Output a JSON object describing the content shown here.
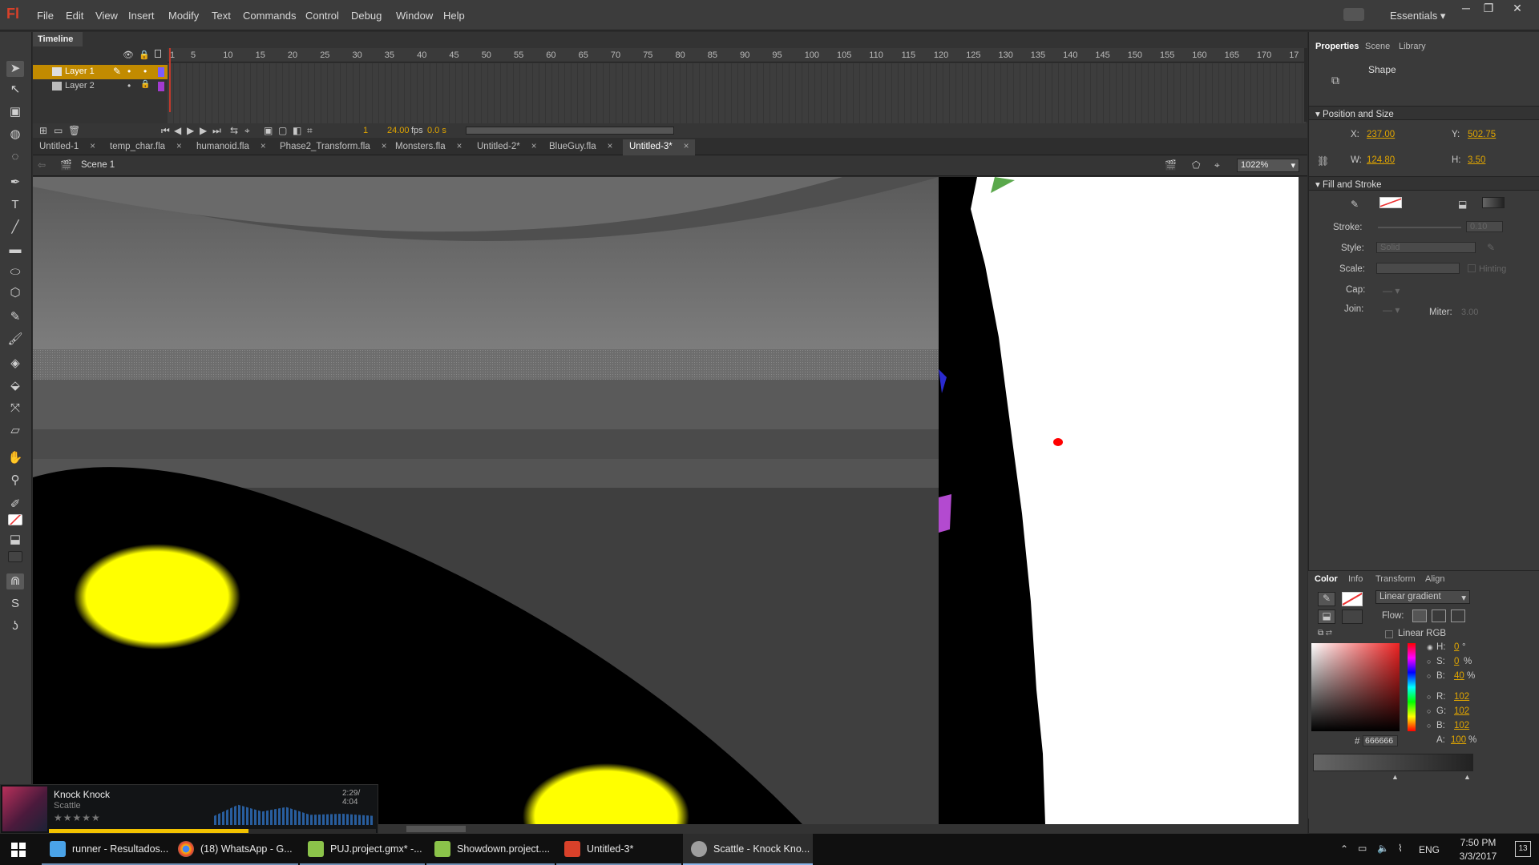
{
  "app": {
    "logo": "Fl",
    "workspace": "Essentials"
  },
  "menu": [
    "File",
    "Edit",
    "View",
    "Insert",
    "Modify",
    "Text",
    "Commands",
    "Control",
    "Debug",
    "Window",
    "Help"
  ],
  "window_controls": {
    "minimize": "─",
    "restore": "❐",
    "close": "✕"
  },
  "timeline": {
    "tab_label": "Timeline",
    "ticks": [
      "1",
      "5",
      "10",
      "15",
      "20",
      "25",
      "30",
      "35",
      "40",
      "45",
      "50",
      "55",
      "60",
      "65",
      "70",
      "75",
      "80",
      "85",
      "90",
      "95",
      "100",
      "105",
      "110",
      "115",
      "120",
      "125",
      "130",
      "135",
      "140",
      "145",
      "150",
      "155",
      "160",
      "165",
      "170",
      "17"
    ],
    "layers": [
      {
        "name": "Layer 1",
        "selected": true,
        "color": "#7b5cff"
      },
      {
        "name": "Layer 2",
        "selected": false,
        "color": "#a23ad0"
      }
    ],
    "current_frame": "1",
    "fps": "24.00",
    "fps_unit": "fps",
    "time": "0.0 s"
  },
  "doc_tabs": [
    "Untitled-1",
    "temp_char.fla",
    "humanoid.fla",
    "Phase2_Transform.fla",
    "Monsters.fla",
    "Untitled-2*",
    "BlueGuy.fla",
    "Untitled-3*"
  ],
  "active_doc_tab": 7,
  "editbar": {
    "scene": "Scene 1",
    "zoom": "1022%"
  },
  "properties": {
    "tabs": [
      "Properties",
      "Scene",
      "Library"
    ],
    "object_type": "Shape",
    "position_section": "Position and Size",
    "x_label": "X:",
    "x_value": "237.00",
    "y_label": "Y:",
    "y_value": "502.75",
    "w_label": "W:",
    "w_value": "124.80",
    "h_label": "H:",
    "h_value": "3.50",
    "fill_section": "Fill and Stroke",
    "stroke_label": "Stroke:",
    "stroke_value": "0.10",
    "style_label": "Style:",
    "style_value": "Solid",
    "scale_label": "Scale:",
    "hinting_label": "Hinting",
    "cap_label": "Cap:",
    "join_label": "Join:",
    "miter_label": "Miter:",
    "miter_value": "3.00"
  },
  "color_panel": {
    "tabs": [
      "Color",
      "Info",
      "Transform",
      "Align"
    ],
    "fill_type": "Linear gradient",
    "flow_label": "Flow:",
    "linear_rgb": "Linear RGB",
    "h_label": "H:",
    "h_value": "0",
    "h_unit": "°",
    "s_label": "S:",
    "s_value": "0",
    "s_unit": "%",
    "b_label": "B:",
    "b_value": "40",
    "b_unit": "%",
    "r_label": "R:",
    "r_value": "102",
    "g_label": "G:",
    "g_value": "102",
    "b2_label": "B:",
    "b2_value": "102",
    "a_label": "A:",
    "a_value": "100",
    "a_unit": "%",
    "hex_label": "#",
    "hex_value": "666666"
  },
  "music": {
    "title": "Knock Knock",
    "artist": "Scattle",
    "time": "2:29/ 4:04",
    "rating": "★★★★★",
    "progress": 0.61
  },
  "taskbar": {
    "items": [
      {
        "label": "runner - Resultados...",
        "color": "#4aa3e8"
      },
      {
        "label": "(18) WhatsApp - G...",
        "color": "#e3a21a"
      },
      {
        "label": "PUJ.project.gmx* -...",
        "color": "#8bc34a"
      },
      {
        "label": "Showdown.project....",
        "color": "#8bc34a"
      },
      {
        "label": "Untitled-3*",
        "color": "#d9412a"
      },
      {
        "label": "Scattle - Knock Kno...",
        "color": "#9e9e9e"
      }
    ],
    "lang": "ENG",
    "time": "7:50 PM",
    "date": "3/3/2017",
    "notifications": "13"
  },
  "colors": {
    "accent": "#e0a500",
    "selection": "#c28b00",
    "stage_dot": "#ff0000",
    "yellow_shape": "#ffff00"
  }
}
